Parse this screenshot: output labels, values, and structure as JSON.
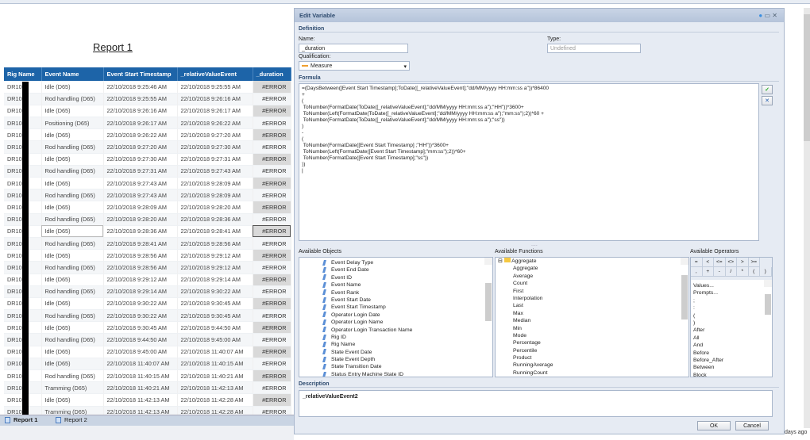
{
  "report": {
    "title": "Report 1",
    "columns": [
      "Rig Name",
      "Event Name",
      "Event Start Timestamp",
      "_relativeValueEvent",
      "_duration"
    ],
    "rows": [
      [
        "DR10",
        "Idle (D65)",
        "22/10/2018 9:25:46 AM",
        "22/10/2018 9:25:55 AM",
        "#ERROR"
      ],
      [
        "DR10",
        "Rod handling (D65)",
        "22/10/2018 9:25:55 AM",
        "22/10/2018 9:26:16 AM",
        "#ERROR"
      ],
      [
        "DR10",
        "Idle (D65)",
        "22/10/2018 9:26:16 AM",
        "22/10/2018 9:26:17 AM",
        "#ERROR"
      ],
      [
        "DR10",
        "Positioning (D65)",
        "22/10/2018 9:26:17 AM",
        "22/10/2018 9:26:22 AM",
        "#ERROR"
      ],
      [
        "DR10",
        "Idle (D65)",
        "22/10/2018 9:26:22 AM",
        "22/10/2018 9:27:20 AM",
        "#ERROR"
      ],
      [
        "DR10",
        "Rod handling (D65)",
        "22/10/2018 9:27:20 AM",
        "22/10/2018 9:27:30 AM",
        "#ERROR"
      ],
      [
        "DR10",
        "Idle (D65)",
        "22/10/2018 9:27:30 AM",
        "22/10/2018 9:27:31 AM",
        "#ERROR"
      ],
      [
        "DR10",
        "Rod handling (D65)",
        "22/10/2018 9:27:31 AM",
        "22/10/2018 9:27:43 AM",
        "#ERROR"
      ],
      [
        "DR10",
        "Idle (D65)",
        "22/10/2018 9:27:43 AM",
        "22/10/2018 9:28:09 AM",
        "#ERROR"
      ],
      [
        "DR10",
        "Rod handling (D65)",
        "22/10/2018 9:27:43 AM",
        "22/10/2018 9:28:09 AM",
        "#ERROR"
      ],
      [
        "DR10",
        "Idle (D65)",
        "22/10/2018 9:28:09 AM",
        "22/10/2018 9:28:20 AM",
        "#ERROR"
      ],
      [
        "DR10",
        "Rod handling (D65)",
        "22/10/2018 9:28:20 AM",
        "22/10/2018 9:28:36 AM",
        "#ERROR"
      ],
      [
        "DR10",
        "Idle (D65)",
        "22/10/2018 9:28:36 AM",
        "22/10/2018 9:28:41 AM",
        "#ERROR"
      ],
      [
        "DR10",
        "Rod handling (D65)",
        "22/10/2018 9:28:41 AM",
        "22/10/2018 9:28:56 AM",
        "#ERROR"
      ],
      [
        "DR10",
        "Idle (D65)",
        "22/10/2018 9:28:56 AM",
        "22/10/2018 9:29:12 AM",
        "#ERROR"
      ],
      [
        "DR10",
        "Rod handling (D65)",
        "22/10/2018 9:28:56 AM",
        "22/10/2018 9:29:12 AM",
        "#ERROR"
      ],
      [
        "DR10",
        "Idle (D65)",
        "22/10/2018 9:29:12 AM",
        "22/10/2018 9:29:14 AM",
        "#ERROR"
      ],
      [
        "DR10",
        "Rod handling (D65)",
        "22/10/2018 9:29:14 AM",
        "22/10/2018 9:30:22 AM",
        "#ERROR"
      ],
      [
        "DR10",
        "Idle (D65)",
        "22/10/2018 9:30:22 AM",
        "22/10/2018 9:30:45 AM",
        "#ERROR"
      ],
      [
        "DR10",
        "Rod handling (D65)",
        "22/10/2018 9:30:22 AM",
        "22/10/2018 9:30:45 AM",
        "#ERROR"
      ],
      [
        "DR10",
        "Idle (D65)",
        "22/10/2018 9:30:45 AM",
        "22/10/2018 9:44:50 AM",
        "#ERROR"
      ],
      [
        "DR10",
        "Rod handling (D65)",
        "22/10/2018 9:44:50 AM",
        "22/10/2018 9:45:00 AM",
        "#ERROR"
      ],
      [
        "DR10",
        "Idle (D65)",
        "22/10/2018 9:45:00 AM",
        "22/10/2018 11:40:07 AM",
        "#ERROR"
      ],
      [
        "DR10",
        "Idle (D65)",
        "22/10/2018 11:40:07 AM",
        "22/10/2018 11:40:15 AM",
        "#ERROR"
      ],
      [
        "DR10",
        "Rod handling (D65)",
        "22/10/2018 11:40:15 AM",
        "22/10/2018 11:40:21 AM",
        "#ERROR"
      ],
      [
        "DR10",
        "Tramming (D65)",
        "22/10/2018 11:40:21 AM",
        "22/10/2018 11:42:13 AM",
        "#ERROR"
      ],
      [
        "DR10",
        "Idle (D65)",
        "22/10/2018 11:42:13 AM",
        "22/10/2018 11:42:28 AM",
        "#ERROR"
      ],
      [
        "DR1017",
        "Tramming (D65)",
        "22/10/2018 11:42:13 AM",
        "22/10/2018 11:42:28 AM",
        "#ERROR"
      ]
    ]
  },
  "tabs": [
    "Report 1",
    "Report 2"
  ],
  "dialog": {
    "title": "Edit Variable",
    "definition": "Definition",
    "name_label": "Name:",
    "name_value": "_duration",
    "type_label": "Type:",
    "type_value": "Undefined",
    "qualification_label": "Qualification:",
    "qualification_value": "Measure",
    "formula_label": "Formula",
    "formula": "=(DaysBetween([Event Start Timestamp];ToDate([_relativeValueEvent];\"dd/MM/yyyy HH:mm:ss a\"))*86400\n+\n(\n ToNumber(FormatDate(ToDate([_relativeValueEvent];\"dd/MM/yyyy HH:mm:ss a\");\"HH\"))*3600+\n ToNumber(Left(FormatDate(ToDate([_relativeValueEvent];\"dd/MM/yyyy HH:mm:ss a\");\"mm:ss\");2))*60 +\n ToNumber(FormatDate(ToDate([_relativeValueEvent];\"dd/MM/yyyy HH:mm:ss a\");\"ss\"))\n)\n-\n(\n ToNumber(FormatDate([Event Start Timestamp] ;\"HH\"))*3600+\n ToNumber(Left(FormatDate([Event Start Timestamp];\"mm:ss\");2))*60+\n ToNumber(FormatDate([Event Start Timestamp];\"ss\"))\n))\n|",
    "objects_label": "Available Objects",
    "objects": [
      "Event Delay Type",
      "Event End Date",
      "Event ID",
      "Event Name",
      "Event Rank",
      "Event Start Date",
      "Event Start Timestamp",
      "Operator Login Date",
      "Operator Login Name",
      "Operator Login Transaction Name",
      "Rig ID",
      "Rig Name",
      "State Event Date",
      "State Event Depth",
      "State Transition Date",
      "Status Entry Machine State ID"
    ],
    "functions_label": "Available Functions",
    "functions_folder": "Aggregate",
    "functions": [
      "Aggregate",
      "Average",
      "Count",
      "First",
      "Interpolation",
      "Last",
      "Max",
      "Median",
      "Min",
      "Mode",
      "Percentage",
      "Percentile",
      "Product",
      "RunningAverage",
      "RunningCount",
      "RunningMax",
      "RunningMin"
    ],
    "operators_label": "Available Operators",
    "operator_buttons": [
      "=",
      "<",
      "<=",
      "<>",
      ">",
      ">=",
      ",",
      "+",
      "-",
      "/",
      "*",
      "(",
      ")"
    ],
    "operators": [
      "Values...",
      "Prompts...",
      ";",
      ":",
      "(",
      ")",
      "After",
      "All",
      "And",
      "Before",
      "Before_After",
      "Between",
      "Block",
      "Body",
      "Bottom",
      "Break"
    ],
    "description_label": "Description",
    "description": "_relativeValueEvent2",
    "ok": "OK",
    "cancel": "Cancel"
  },
  "status": "days ago"
}
